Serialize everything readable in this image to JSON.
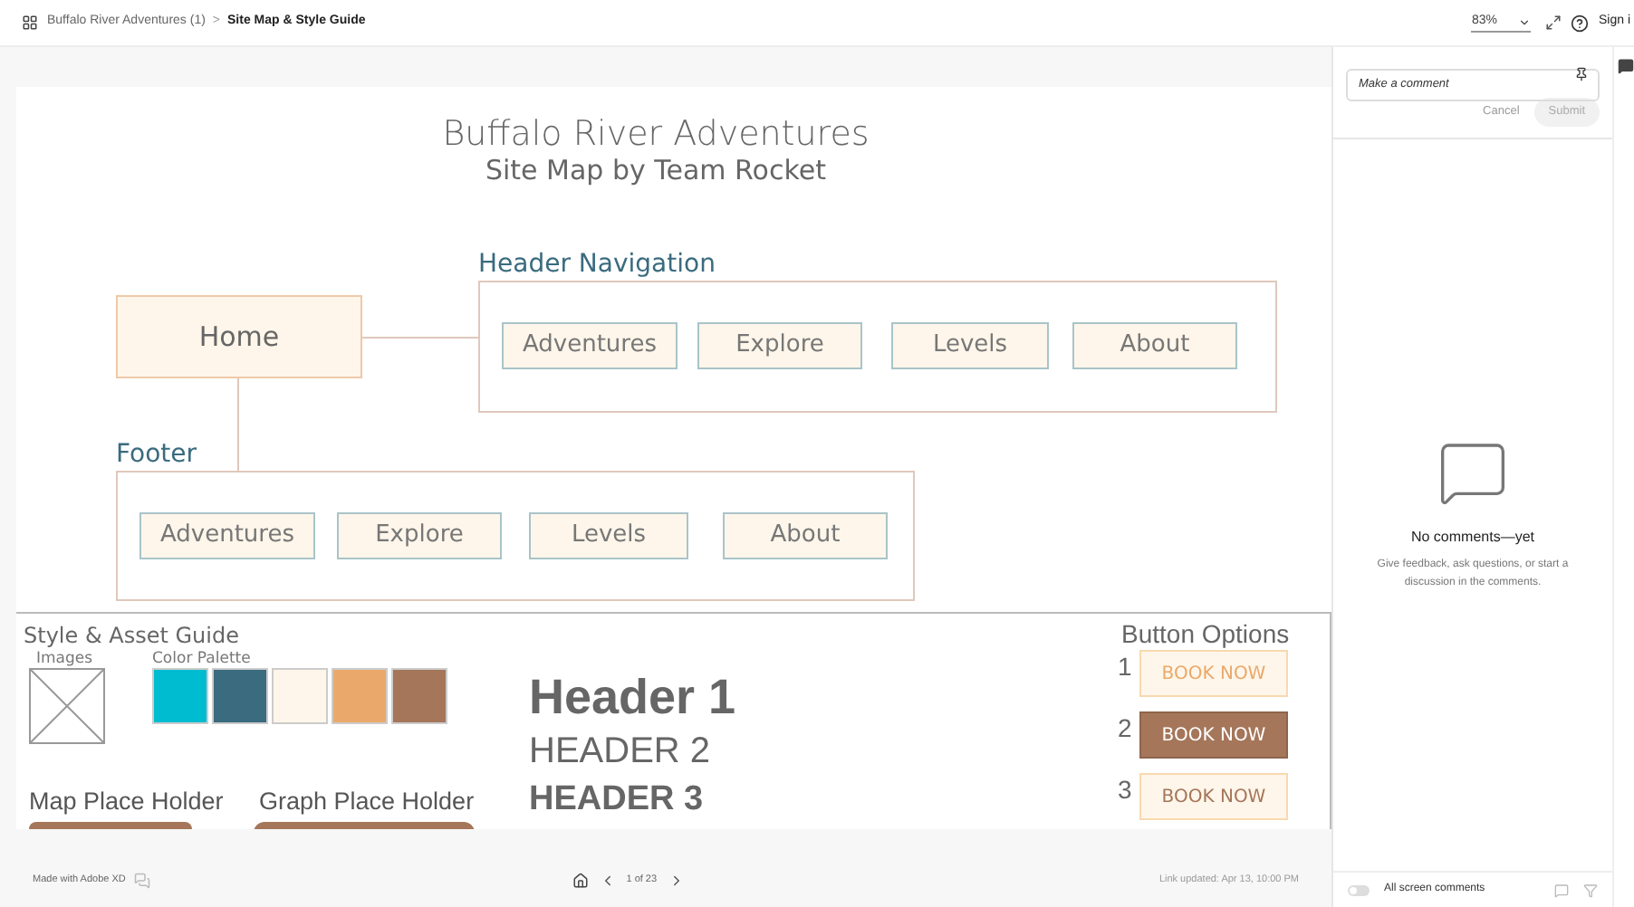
{
  "topbar": {
    "parent": "Buffalo River Adventures (1)",
    "separator": ">",
    "current": "Site Map & Style Guide",
    "zoom": "83%",
    "sign_in": "Sign i"
  },
  "artboard": {
    "title": "Buffalo River Adventures",
    "subtitle": "Site Map by Team Rocket",
    "home": "Home",
    "header_nav": {
      "title": "Header Navigation",
      "items": [
        "Adventures",
        "Explore",
        "Levels",
        "About"
      ]
    },
    "footer": {
      "title": "Footer",
      "items": [
        "Adventures",
        "Explore",
        "Levels",
        "About"
      ]
    },
    "style_guide": {
      "title": "Style & Asset Guide",
      "images_label": "Images",
      "palette_label": "Color Palette",
      "palette": [
        {
          "color": "#00bcd0"
        },
        {
          "color": "#3a6b7e"
        },
        {
          "color": "#fef6ea"
        },
        {
          "color": "#eaa96a"
        },
        {
          "color": "#a5765a"
        }
      ],
      "headers": [
        {
          "kind": "h1",
          "text": "Header 1"
        },
        {
          "kind": "h2",
          "text": "HEADER 2"
        },
        {
          "kind": "h3",
          "text": "HEADER 3"
        }
      ],
      "map_label": "Map Place Holder",
      "graph_label": "Graph Place Holder",
      "button_options": {
        "title": "Button Options",
        "buttons": [
          {
            "number": "1",
            "label": "BOOK NOW",
            "kind": "light"
          },
          {
            "number": "2",
            "label": "BOOK NOW",
            "kind": "filled"
          },
          {
            "number": "3",
            "label": "BOOK NOW",
            "kind": "outline"
          }
        ]
      }
    }
  },
  "bottombar": {
    "made_with": "Made with Adobe XD",
    "page": "1 of 23",
    "link_updated": "Link updated: Apr 13, 10:00 PM"
  },
  "comments": {
    "placeholder": "Make a comment",
    "cancel": "Cancel",
    "submit": "Submit",
    "empty_title": "No comments—yet",
    "empty_text": "Give feedback, ask questions, or start a discussion in the comments.",
    "toggle": {
      "label": "All screen comments",
      "on": false
    }
  }
}
